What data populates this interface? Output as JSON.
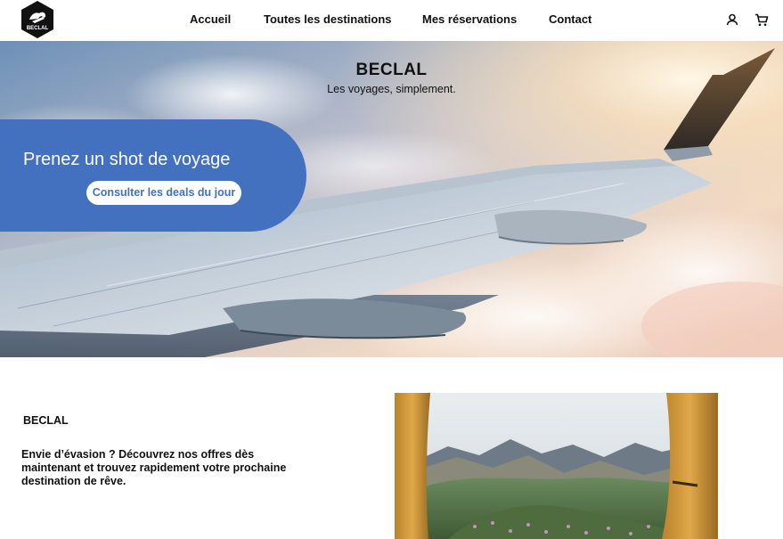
{
  "header": {
    "logo_text": "BECLAL",
    "nav": [
      "Accueil",
      "Toutes les destinations",
      "Mes réservations",
      "Contact"
    ],
    "icons": [
      "user-icon",
      "cart-icon"
    ]
  },
  "hero": {
    "title": "BECLAL",
    "subtitle": "Les voyages, simplement.",
    "promo_text": "Prenez un shot de voyage",
    "promo_button": "Consulter les deals du jour"
  },
  "section": {
    "brand": "BECLAL",
    "description": "Envie d’évasion ? Découvrez nos offres dès maintenant et trouvez rapidement votre prochaine destination de rêve."
  },
  "colors": {
    "accent": "#4471bf",
    "text": "#111111",
    "background": "#ffffff"
  }
}
